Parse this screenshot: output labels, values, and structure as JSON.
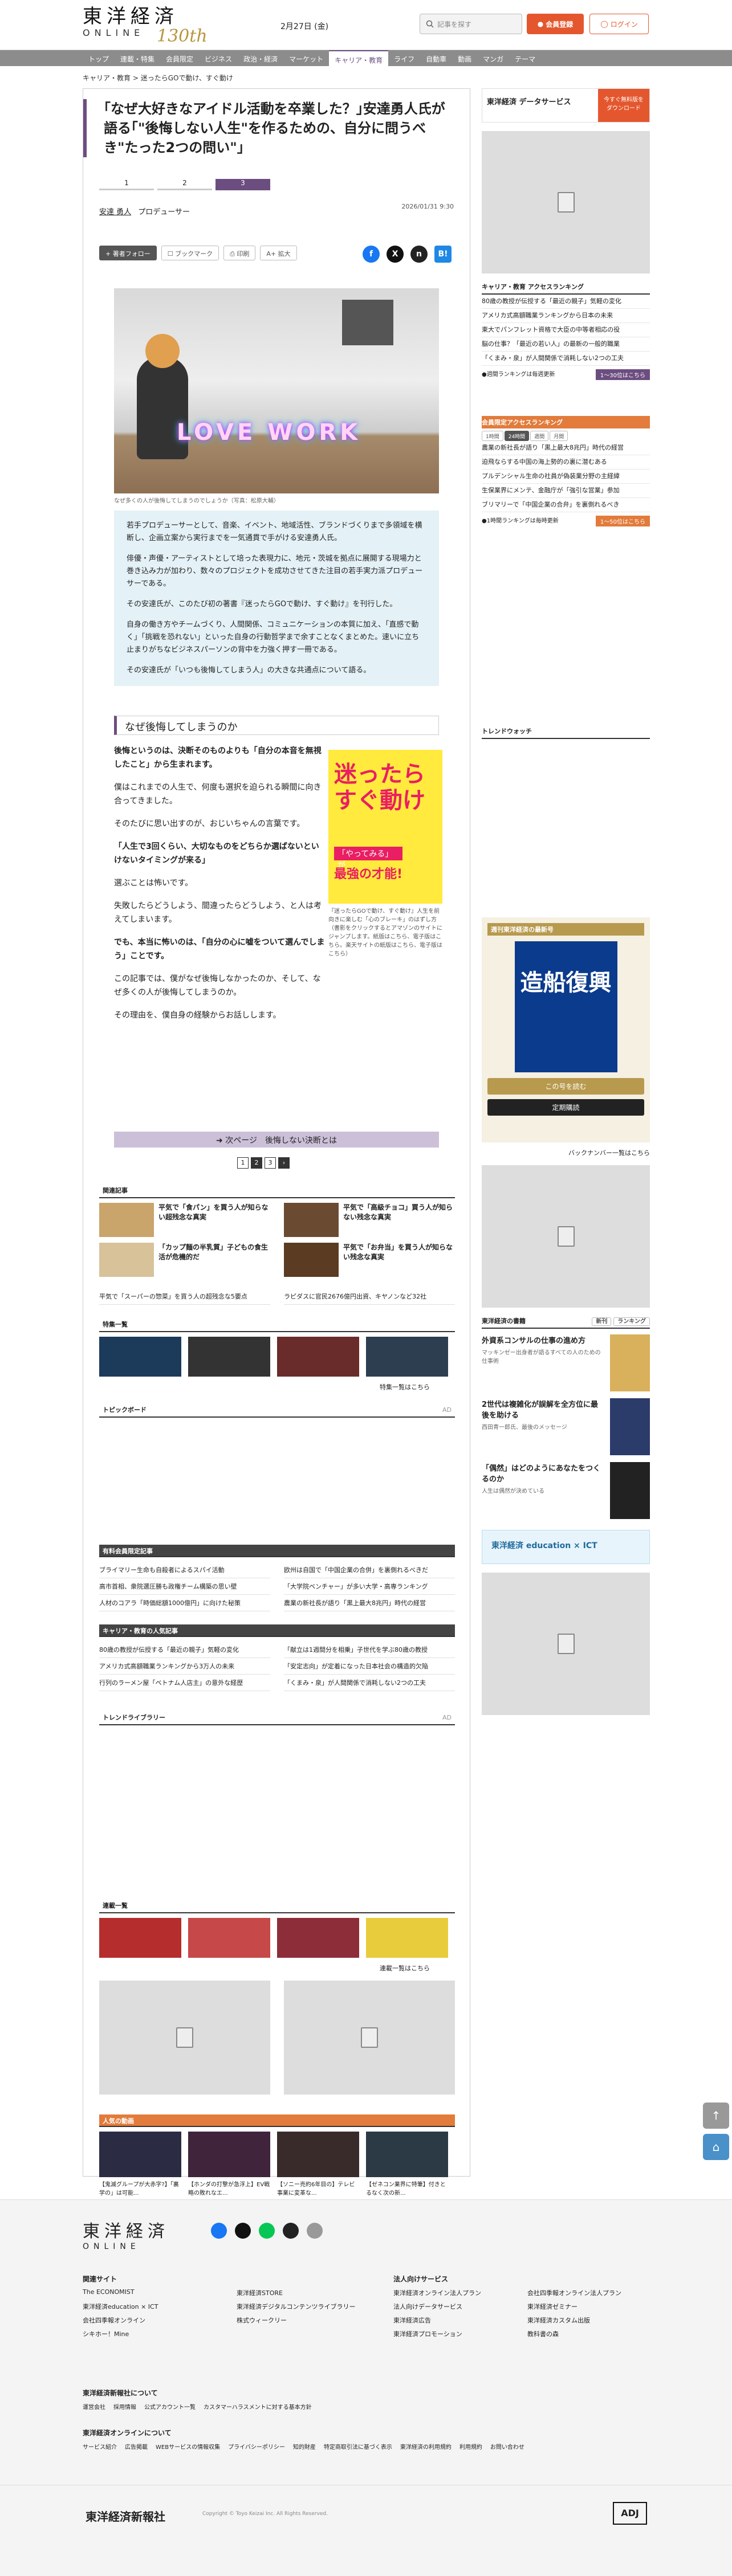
{
  "header": {
    "logo_jp": "東洋経済",
    "logo_en": "ONLINE",
    "logo_anniv": "130th",
    "date": "2月27日 (金)",
    "search_placeholder": "記事を探す",
    "member_label": "会員登録",
    "login_label": "ログイン"
  },
  "nav": [
    "トップ",
    "連載・特集",
    "会員限定",
    "ビジネス",
    "政治・経済",
    "マーケット",
    "キャリア・教育",
    "ライフ",
    "自動車",
    "動画",
    "マンガ",
    "テーマ"
  ],
  "nav_active_index": 6,
  "breadcrumb": [
    "キャリア・教育",
    "迷ったらGOで動け、すぐ動け"
  ],
  "article": {
    "title": "｢なぜ大好きなアイドル活動を卒業した？｣安達勇人氏が語る｢\"後悔しない人生\"を作るための、自分に問うべき\"たった2つの問い\"｣",
    "page_tabs": [
      "1",
      "2",
      "3"
    ],
    "author_name": "安達 勇人",
    "author_role": "プロデューサー",
    "pubdate": "2026/01/31 9:30",
    "toolbar": {
      "follow": "著者フォロー",
      "bookmark": "ブックマーク",
      "print": "印刷",
      "zoom": "A+ 拡大"
    },
    "photo_neon": "LOVE WORK",
    "photo_caption": "なぜ多くの人が後悔してしまうのでしょうか（写真：松原大輔）",
    "lead": [
      "若手プロデューサーとして、音楽、イベント、地域活性、ブランドづくりまで多領域を横断し、企画立案から実行までを一気通貫で手がける安達勇人氏。",
      "俳優・声優・アーティストとして培った表現力に、地元・茨城を拠点に展開する現場力と巻き込み力が加わり、数々のプロジェクトを成功させてきた注目の若手実力派プロデューサーである。",
      "その安達氏が、このたび初の著書『迷ったらGOで動け、すぐ動け』を刊行した。",
      "自身の働き方やチームづくり、人間関係、コミュニケーションの本質に加え、「直感で動く」「挑戦を恐れない」といった自身の行動哲学まで余すことなくまとめた。速いに立ち止まりがちなビジネスパーソンの背中を力強く押す一冊である。",
      "その安達氏が「いつも後悔してしまう人」の大きな共通点について語る。"
    ],
    "section_heading": "なぜ後悔してしまうのか",
    "body": [
      "後悔というのは、決断そのものよりも「自分の本音を無視したこと」から生まれます。",
      "僕はこれまでの人生で、何度も選択を迫られる瞬間に向き合ってきました。",
      "そのたびに思い出すのが、おじいちゃんの言葉です。",
      "「人生で3回くらい、大切なものをどちらか選ばないといけないタイミングが来る」",
      "選ぶことは怖いです。",
      "失敗したらどうしよう、間違ったらどうしよう、と人は考えてしまいます。",
      "でも、本当に怖いのは、「自分の心に嘘をついて選んでしまう」ことです。",
      "この記事では、僕がなぜ後悔しなかったのか、そして、なぜ多くの人が後悔してしまうのか。",
      "その理由を、僕自身の経験からお話しします。"
    ],
    "book": {
      "cover_title": "迷ったら すぐ動け",
      "cover_band": "「やってみる」が",
      "cover_sub": "最強の才能!",
      "caption": "『迷ったらGOで動け、すぐ動け』人生を前向きに楽しむ「心のブレーキ」のはずし方（書影をクリックするとアマゾンのサイトにジャンプします。紙版はこちら、電子版はこちら。楽天サイトの紙版はこちら、電子版はこちら）"
    },
    "next_label": "次ページ　後悔しない決断とは",
    "pages": [
      "1",
      "2",
      "3"
    ]
  },
  "related": {
    "title": "関連記事",
    "items": [
      "平気で「食パン」を買う人が知らない超残念な真実",
      "平気で「高級チョコ」買う人が知らない残念な真実",
      "「カップ麺の半乳質」子どもの食生活が危機的だ",
      "平気で「お弁当」を買う人が知らない残念な真実"
    ],
    "text_items": [
      "平気で「スーパーの惣菜」を買う人の超残念な5要点",
      "ラピダスに官民2676億円出資、キヤノンなど32社"
    ]
  },
  "special": {
    "title": "特集一覧",
    "more": "特集一覧はこちら"
  },
  "topic_board": {
    "title": "トピックボード",
    "ad": "AD"
  },
  "member_ranking": {
    "title": "有料会員限定記事",
    "items": [
      "ブライマリー生命も自殺者によるスパイ活動",
      "欧州は自国で「中国企業の合併」を裏側れるべきだ",
      "高市首相、衆院選圧勝も政権チーム構築の思い壁",
      "「大学院ベンチャー」が多い大学・高専ランキング",
      "人材のコアラ「時価総額1000億円」に向けた秘策",
      "農業の新社長が語り「黒上最大8兆円」時代の経営"
    ]
  },
  "career_ranking": {
    "title": "キャリア・教育の人気記事",
    "items": [
      "80歳の教授が伝授する「最近の親子」気軽の変化",
      "「献立は1週間分を相乗」子世代を学ぶ80歳の教授",
      "アメリカ式高額職業ランキングから3万人の未来",
      "「安定志向」が定着になった日本社会の構造的欠陥",
      "行列のラーメン屋「ベトナム人店主」の意外な経歴",
      "「くまみ・泉」が人間関係で消耗しない2つの工夫"
    ]
  },
  "trend_library": {
    "title": "トレンドライブラリー",
    "ad": "AD"
  },
  "series": {
    "title": "連載一覧",
    "more": "連載一覧はこちら"
  },
  "popular": {
    "title": "人気の動画",
    "items": [
      "【鬼滅グループが大赤字?】「裏学の」は可能...",
      "【ホンダの打撃が急浮上】EV戦略の敗れなエ...",
      "【ソニー売約6年目の】テレビ事業に変革な...",
      "【ゼネコン業界に特筆】付きとるなく次の新..."
    ]
  },
  "sidebar": {
    "data_service_logo": "東洋経済 データサービス",
    "data_service_cta": "今すぐ無料版をダウンロード",
    "ranking_title": "キャリア・教育 アクセスランキング",
    "ranking_items": [
      "80歳の教授が伝授する「最近の親子」気軽の変化",
      "アメリカ式高額職業ランキングから日本の未来",
      "東大でパンフレット資格で大臣の中等者相応の役",
      "脳の仕事？「最近の若い人」の最新の一般的職業",
      "「くまみ・泉」が人間関係で消耗しない2つの工夫"
    ],
    "ranking_note": "●週間ランキングは毎週更新",
    "ranking_more": "1〜30位はこちら",
    "ranking2_title": "会員限定アクセスランキング",
    "ranking2_tabs": [
      "1時間",
      "24時間",
      "週間",
      "月間"
    ],
    "ranking2_items": [
      "農業の新社長が語り「黒上最大8兆円」時代の経営",
      "迫飛ならする中国の海上勢的の裏に潜むある",
      "プルデンシャル生命の社員が偽装業分野の主経緯",
      "生保業界にメンテ、金融庁が「強引な営業」参加",
      "ブリマリーで「中国企業の合弁」を裏側れるべき"
    ],
    "ranking2_note": "●1時間ランキングは毎時更新",
    "ranking2_more": "1〜50位はこちら",
    "trend_watch": "トレンドウォッチ",
    "weekly_title": "週刊東洋経済の最新号",
    "weekly_cover": "造船復興",
    "weekly_buy": "この号を読む",
    "weekly_sub": "定期購読",
    "weekly_back": "バックナンバー一覧はこちら",
    "shop_title": "東洋経済の書籍",
    "shop_tabs": [
      "新刊",
      "ランキング"
    ],
    "books": [
      {
        "title": "外資系コンサルの仕事の進め方",
        "sub": "マッキンゼー出身者が語るすべての人のための仕事術"
      },
      {
        "title": "2世代は複雑化が誤解を全方位に最後を助ける",
        "sub": "西田青一郎氏、最後のメッセージ"
      },
      {
        "title": "「偶然」はどのようにあなたをつくるのか",
        "sub": "人生は偶然が決めている"
      }
    ],
    "education_banner": "東洋経済 education × ICT"
  },
  "footer": {
    "logo_jp": "東洋経済",
    "logo_en": "ONLINE",
    "left_title": "関連サイト",
    "left_links": [
      "The ECONOMIST",
      "東洋経済STORE",
      "東洋経済education × ICT",
      "東洋経済デジタルコンテンツライブラリー",
      "会社四季報オンライン",
      "株式ウィークリー",
      "シキホー！Mine"
    ],
    "right_title": "法人向けサービス",
    "right_links": [
      "東洋経済オンライン法人プラン",
      "会社四季報オンライン法人プラン",
      "法人向けデータサービス",
      "東洋経済ゼミナー",
      "東洋経済広告",
      "東洋経済カスタム出版",
      "東洋経済プロモーション",
      "教科書の森"
    ],
    "about_title": "東洋経済新報社について",
    "about_links": [
      "運営会社",
      "採用情報",
      "公式アカウント一覧",
      "カスタマーハラスメントに対する基本方針"
    ],
    "online_title": "東洋経済オンラインについて",
    "online_links": [
      "サービス紹介",
      "広告掲載",
      "WEBサービスの情報収集",
      "プライバシーポリシー",
      "知的財産",
      "特定商取引法に基づく表示",
      "東洋経済の利用規約",
      "利用規約",
      "お問い合わせ"
    ],
    "company": "東洋経済新報社",
    "copyright": "Copyright © Toyo Keizai Inc. All Rights Reserved.",
    "adj": "ADJ"
  },
  "colors": {
    "accent": "#6c4d80",
    "orange": "#e4572e",
    "nav": "#8c8c8c"
  }
}
